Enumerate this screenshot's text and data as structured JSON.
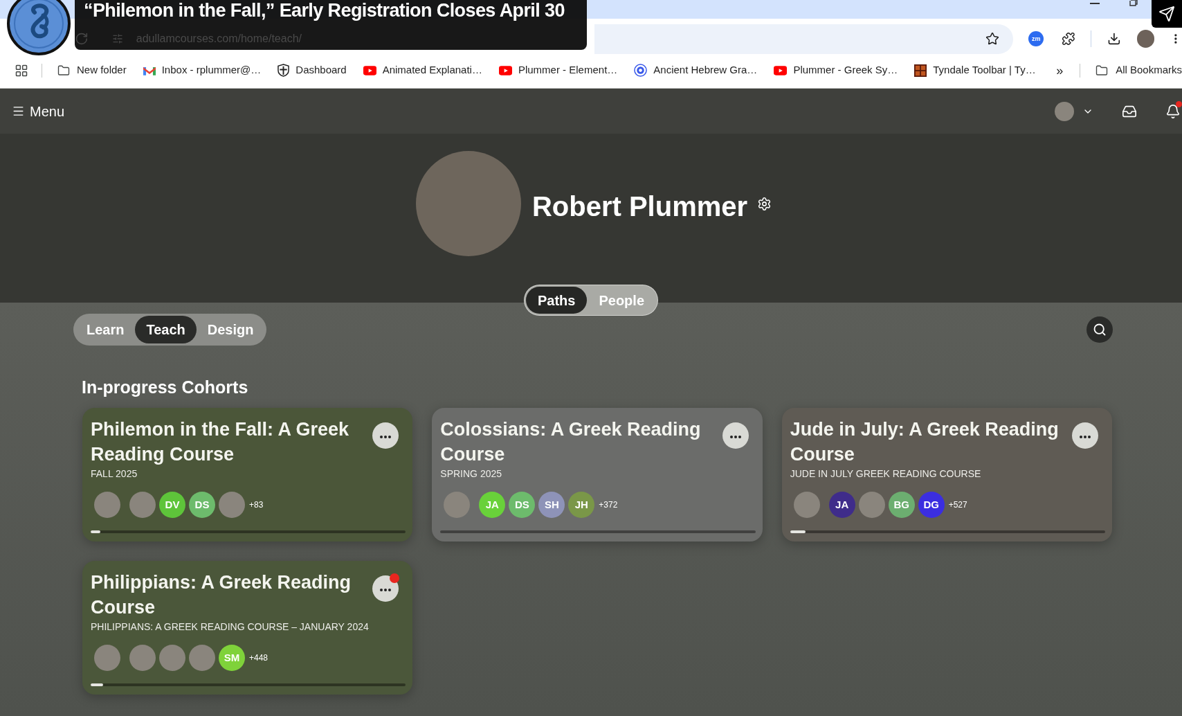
{
  "browser": {
    "url": "adullamcourses.com/home/teach/",
    "extension_label": "zm",
    "bookmarks": [
      {
        "kind": "folder",
        "label": "New folder"
      },
      {
        "kind": "mail",
        "label": "Inbox - rplummer@…"
      },
      {
        "kind": "shield",
        "label": "Dashboard"
      },
      {
        "kind": "video",
        "label": "Animated Explanati…"
      },
      {
        "kind": "video",
        "label": "Plummer - Element…"
      },
      {
        "kind": "blog",
        "label": "Ancient Hebrew Gra…"
      },
      {
        "kind": "video",
        "label": "Plummer - Greek Sy…"
      },
      {
        "kind": "tile",
        "label": "Tyndale Toolbar | Ty…"
      }
    ],
    "overflow": "»",
    "all_bookmarks": "All Bookmarks"
  },
  "banner": {
    "title": "“Philemon in the Fall,” Early Registration Closes April 30"
  },
  "header": {
    "menu_label": "Menu",
    "notifications_unread": true
  },
  "profile": {
    "name": "Robert Plummer"
  },
  "view_toggle": [
    {
      "label": "Paths",
      "selected": true
    },
    {
      "label": "People",
      "selected": false
    }
  ],
  "mode_tabs": [
    {
      "label": "Learn",
      "selected": false
    },
    {
      "label": "Teach",
      "selected": true
    },
    {
      "label": "Design",
      "selected": false
    }
  ],
  "section_title": "In-progress Cohorts",
  "cohorts": [
    {
      "title": "Philemon in the Fall: A Greek Reading Course",
      "subtitle": "FALL 2025",
      "color": "#4b5639",
      "unread": false,
      "members": [
        {
          "kind": "photo"
        },
        {
          "kind": "photo"
        },
        {
          "kind": "initials",
          "initials": "DV",
          "color": "#5ec43a"
        },
        {
          "kind": "initials",
          "initials": "DS",
          "color": "#6dbb6c"
        },
        {
          "kind": "photo"
        }
      ],
      "more_count": "+83",
      "level": 0.03
    },
    {
      "title": "Colossians: A Greek Reading Course",
      "subtitle": "SPRING 2025",
      "color": "#6b6c6a",
      "unread": false,
      "members": [
        {
          "kind": "photo"
        },
        {
          "kind": "initials",
          "initials": "JA",
          "color": "#69d13a"
        },
        {
          "kind": "initials",
          "initials": "DS",
          "color": "#6dbb6c"
        },
        {
          "kind": "initials",
          "initials": "SH",
          "color": "#8e93b8"
        },
        {
          "kind": "initials",
          "initials": "JH",
          "color": "#7a9748"
        }
      ],
      "more_count": "+372",
      "level": 0
    },
    {
      "title": "Jude in July: A Greek Reading Course",
      "subtitle": "JUDE IN JULY GREEK READING COURSE",
      "color": "#5f5b54",
      "unread": false,
      "members": [
        {
          "kind": "photo"
        },
        {
          "kind": "initials",
          "initials": "JA",
          "color": "#3f2c8a"
        },
        {
          "kind": "photo"
        },
        {
          "kind": "initials",
          "initials": "BG",
          "color": "#6cae70"
        },
        {
          "kind": "initials",
          "initials": "DG",
          "color": "#3b2ee0"
        }
      ],
      "more_count": "+527",
      "level": 0.05
    },
    {
      "title": "Philippians: A Greek Reading Course",
      "subtitle": "PHILIPPIANS: A GREEK READING COURSE – JANUARY 2024",
      "color": "#4b573a",
      "unread": true,
      "members": [
        {
          "kind": "photo"
        },
        {
          "kind": "photo"
        },
        {
          "kind": "photo"
        },
        {
          "kind": "photo"
        },
        {
          "kind": "initials",
          "initials": "SM",
          "color": "#7fd23a"
        }
      ],
      "more_count": "+448",
      "level": 0.04
    }
  ]
}
